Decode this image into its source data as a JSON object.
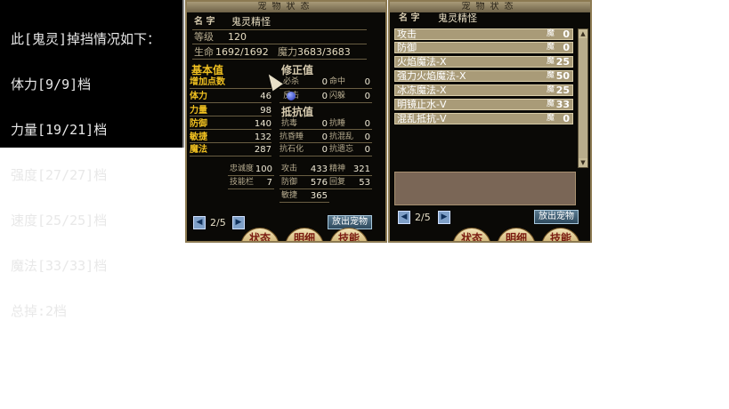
{
  "console": {
    "lines": [
      "此[鬼灵]掉挡情况如下：",
      "体力[9/9]档",
      "力量[19/21]档",
      "强度[27/27]档",
      "速度[25/25]档",
      "魔法[33/33]档",
      "总掉:2档"
    ]
  },
  "status_panel": {
    "title": "宠物状态",
    "name_label": "名 字",
    "name": "鬼灵精怪",
    "level_label": "等级",
    "level": "120",
    "hp_label": "生命",
    "hp": "1692/1692",
    "mp_label": "魔力",
    "mp": "3683/3683",
    "base_header": "基本值",
    "mod_header": "修正值",
    "resist_header": "抵抗值",
    "base": [
      {
        "label": "增加点数",
        "value": ""
      },
      {
        "label": "体力",
        "value": "46"
      },
      {
        "label": "力量",
        "value": "98"
      },
      {
        "label": "防御",
        "value": "140"
      },
      {
        "label": "敏捷",
        "value": "132"
      },
      {
        "label": "魔法",
        "value": "287"
      }
    ],
    "mod": [
      {
        "l1": "必杀",
        "v1": "0",
        "l2": "命中",
        "v2": "0"
      },
      {
        "l1": "反击",
        "v1": "0",
        "l2": "闪躲",
        "v2": "0"
      }
    ],
    "resist": [
      {
        "l1": "抗毒",
        "v1": "0",
        "l2": "抗睡",
        "v2": "0"
      },
      {
        "l1": "抗昏睡",
        "v1": "0",
        "l2": "抗混乱",
        "v2": "0"
      },
      {
        "l1": "抗石化",
        "v1": "0",
        "l2": "抗遗忘",
        "v2": "0"
      }
    ],
    "loyalty_label": "忠诚度",
    "loyalty": "100",
    "skill_slots_label": "技能栏",
    "skill_slots": "7",
    "derived": [
      {
        "l1": "攻击",
        "v1": "433",
        "l2": "精神",
        "v2": "321"
      },
      {
        "l1": "防御",
        "v1": "576",
        "l2": "回复",
        "v2": "53"
      },
      {
        "l1": "敏捷",
        "v1": "365",
        "l2": "",
        "v2": ""
      }
    ],
    "page": "2/5",
    "release_label": "放出宠物",
    "tabs": [
      "状态",
      "明细",
      "技能"
    ]
  },
  "skill_panel": {
    "title": "宠物状态",
    "name_label": "名 字",
    "name": "鬼灵精怪",
    "mp_tag": "魔",
    "skills": [
      {
        "name": "攻击",
        "cost": "0"
      },
      {
        "name": "防御",
        "cost": "0"
      },
      {
        "name": "火焰魔法-X",
        "cost": "25"
      },
      {
        "name": "强力火焰魔法-X",
        "cost": "50"
      },
      {
        "name": "冰冻魔法-X",
        "cost": "25"
      },
      {
        "name": "明镜止水-V",
        "cost": "33"
      },
      {
        "name": "混乱抵抗-V",
        "cost": "0"
      }
    ],
    "page": "2/5",
    "release_label": "放出宠物",
    "tabs": [
      "状态",
      "明细",
      "技能"
    ]
  },
  "colors": {
    "panel_bg": "#0a0906",
    "highlight": "#f0c020",
    "skill_row": "#a99b78",
    "memo": "#7a6656"
  }
}
